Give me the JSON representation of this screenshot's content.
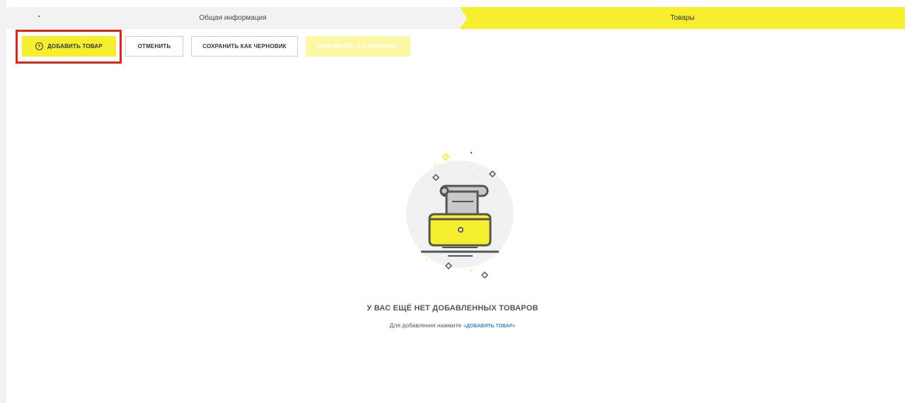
{
  "stepper": {
    "steps": [
      {
        "label": "Общая информация",
        "state": "completed"
      },
      {
        "label": "Товары",
        "state": "active"
      }
    ]
  },
  "toolbar": {
    "add_label": "ДОБАВИТЬ ТОВАР",
    "cancel_label": "ОТМЕНИТЬ",
    "draft_label": "СОХРАНИТЬ КАК ЧЕРНОВИК",
    "sign_label": "ПОДПИСАТЬ И ОТПРАВИТЬ",
    "add_icon": "plus-circle-icon"
  },
  "empty_state": {
    "title": "У ВАС ЕЩЁ НЕТ ДОБАВЛЕННЫХ ТОВАРОВ",
    "hint": "Для добавления нажмите",
    "hint_link": "«ДОБАВИТЬ ТОВАР»",
    "illustration": "empty-folder-scroll-icon"
  },
  "colors": {
    "accent": "#f6ef2e",
    "accent_disabled": "#fbf7a3",
    "link": "#3d86c6",
    "highlight": "#e2231a",
    "step_inactive_bg": "#f2f2f2"
  }
}
